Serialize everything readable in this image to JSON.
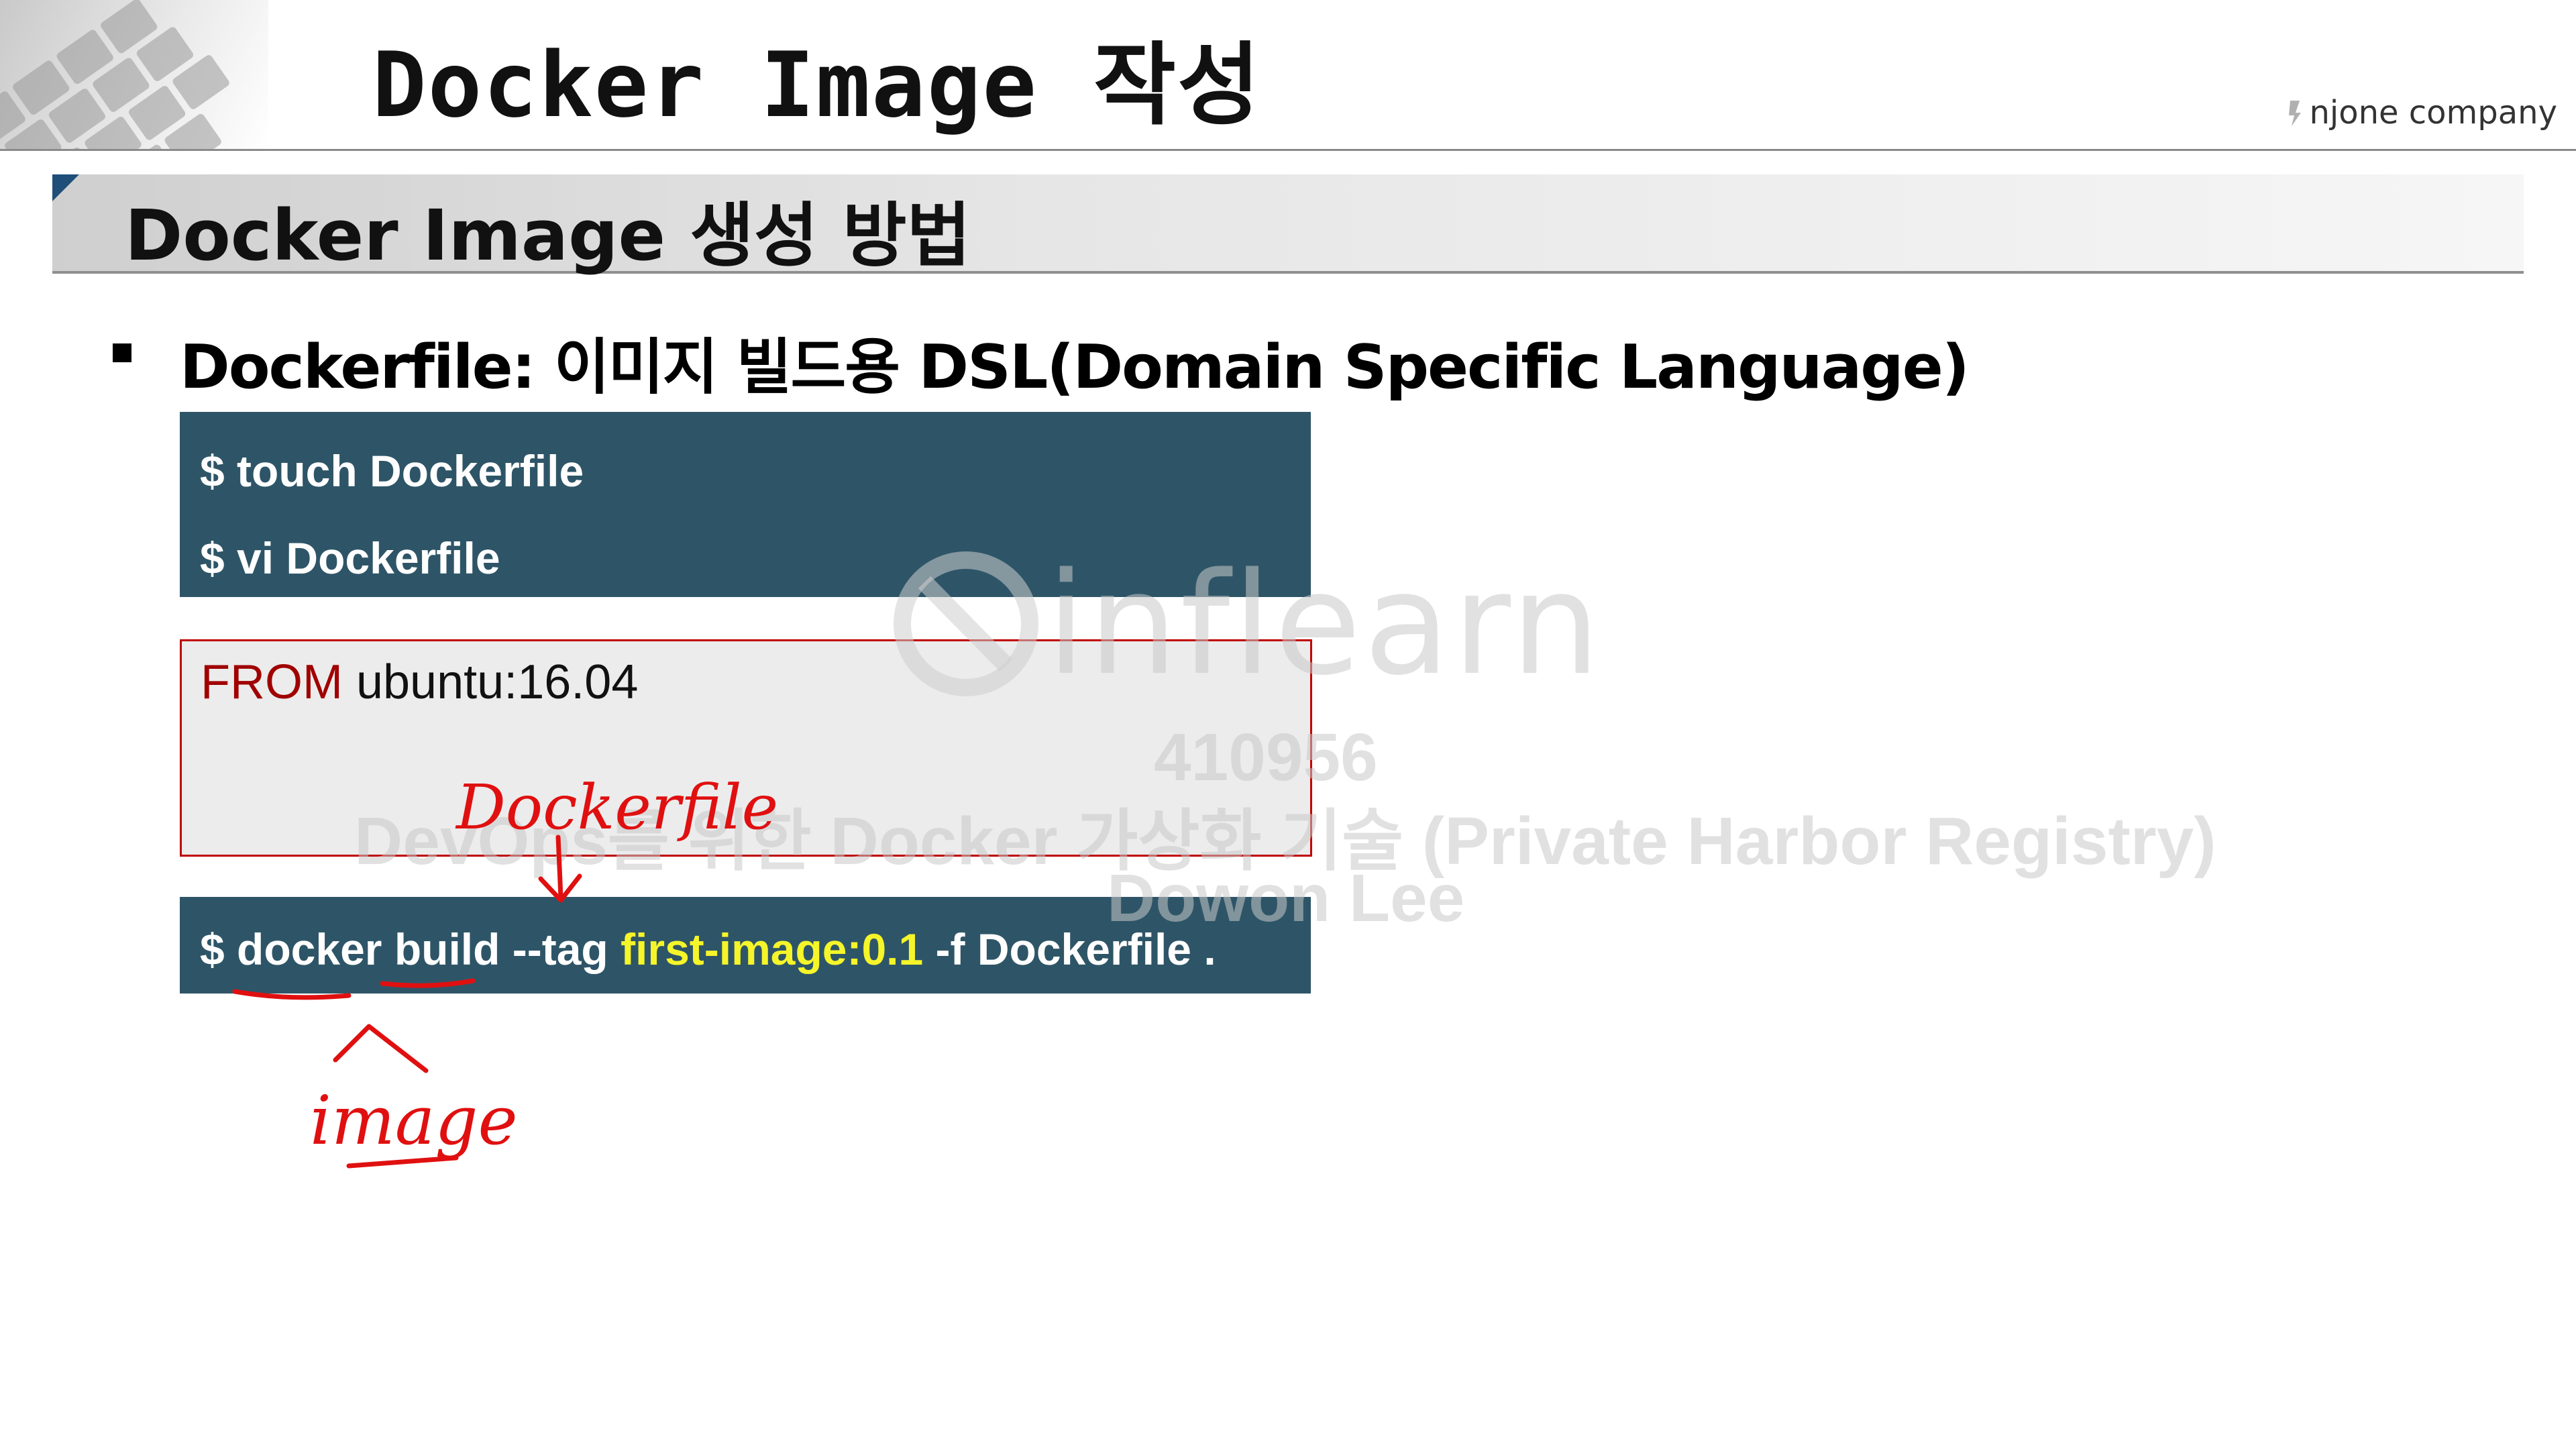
{
  "header": {
    "title": "Docker Image 작성",
    "brand": "njone company"
  },
  "section": {
    "subtitle": "Docker Image 생성 방법"
  },
  "bullet": {
    "text": "Dockerfile: 이미지 빌드용 DSL(Domain Specific Language)"
  },
  "commands": {
    "line1": "$ touch Dockerfile",
    "line2": "$ vi Dockerfile"
  },
  "dockerfile": {
    "keyword": "FROM",
    "value": " ubuntu:16.04"
  },
  "build": {
    "prefix": "$ docker build --tag ",
    "tag": "first-image:0.1",
    "suffix": " -f Dockerfile ."
  },
  "annotations": {
    "dockerfile_note": "Dockerfile",
    "image_note": "image"
  },
  "watermark": {
    "logo": "inflearn",
    "id": "410956",
    "course": "DevOps를 위한 Docker 가상화 기술 (Private Harbor Registry)",
    "author": "Dowon Lee"
  },
  "colors": {
    "command_bg": "#2e5567",
    "keyword": "#a00000",
    "highlight": "#f5f52a",
    "annotation": "#e01010",
    "accent": "#1f4e79"
  }
}
